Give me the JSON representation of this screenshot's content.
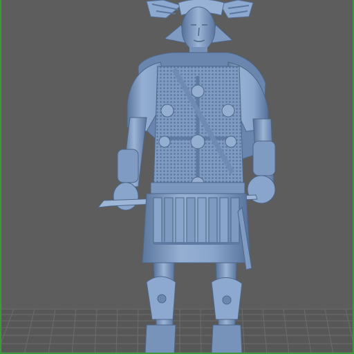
{
  "viewport": {
    "background_color": "#5d5d5d",
    "grid_color": "#6e6e6e",
    "grid_floor_color": "#575757",
    "frame_color": "#3c9a3c"
  },
  "model": {
    "subject": "roman-centurion-statue",
    "surface_color": "#7f9cc4",
    "highlight_color": "#a9c0de",
    "shadow_color": "#4e6688"
  }
}
